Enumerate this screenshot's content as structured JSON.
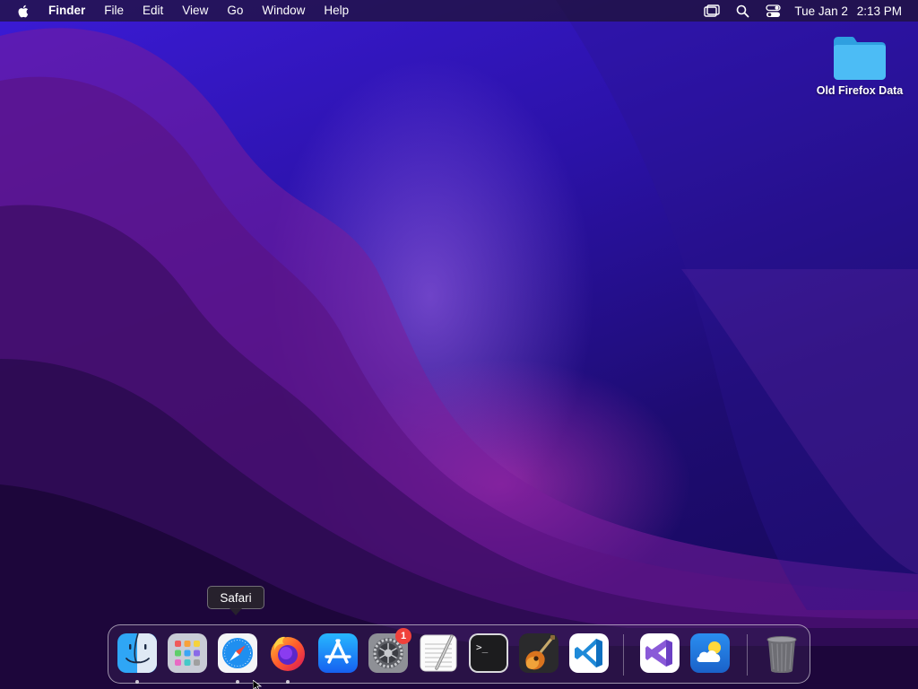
{
  "menubar": {
    "app_name": "Finder",
    "menus": [
      "File",
      "Edit",
      "View",
      "Go",
      "Window",
      "Help"
    ],
    "status_icons": [
      "screen-mirroring-icon",
      "search-icon",
      "control-center-icon"
    ],
    "clock": {
      "date": "Tue Jan 2",
      "time": "2:13 PM"
    }
  },
  "desktop": {
    "folder_label": "Old Firefox Data",
    "folder_color": "#3fb3f0"
  },
  "dock": {
    "tooltip": "Safari",
    "items": [
      {
        "name": "Finder",
        "icon": "finder-icon",
        "running": true
      },
      {
        "name": "Launchpad",
        "icon": "launchpad-icon",
        "running": false
      },
      {
        "name": "Safari",
        "icon": "safari-icon",
        "running": true
      },
      {
        "name": "Firefox",
        "icon": "firefox-icon",
        "running": true
      },
      {
        "name": "App Store",
        "icon": "app-store-icon",
        "running": false
      },
      {
        "name": "System Settings",
        "icon": "settings-gear-icon",
        "running": false,
        "badge": "1"
      },
      {
        "name": "TextEdit",
        "icon": "textedit-icon",
        "running": false
      },
      {
        "name": "Terminal",
        "icon": "terminal-icon",
        "running": false
      },
      {
        "name": "GarageBand",
        "icon": "garageband-icon",
        "running": false
      },
      {
        "name": "Visual Studio Code",
        "icon": "vscode-icon",
        "running": false
      },
      {
        "name": "Visual Studio",
        "icon": "visual-studio-icon",
        "running": false
      },
      {
        "name": "Weather",
        "icon": "weather-icon",
        "running": false
      },
      {
        "name": "Trash",
        "icon": "trash-icon",
        "running": false
      }
    ],
    "terminal_prompt": ">_"
  },
  "colors": {
    "accent": "#0a84ff",
    "badge": "#f0413b"
  }
}
